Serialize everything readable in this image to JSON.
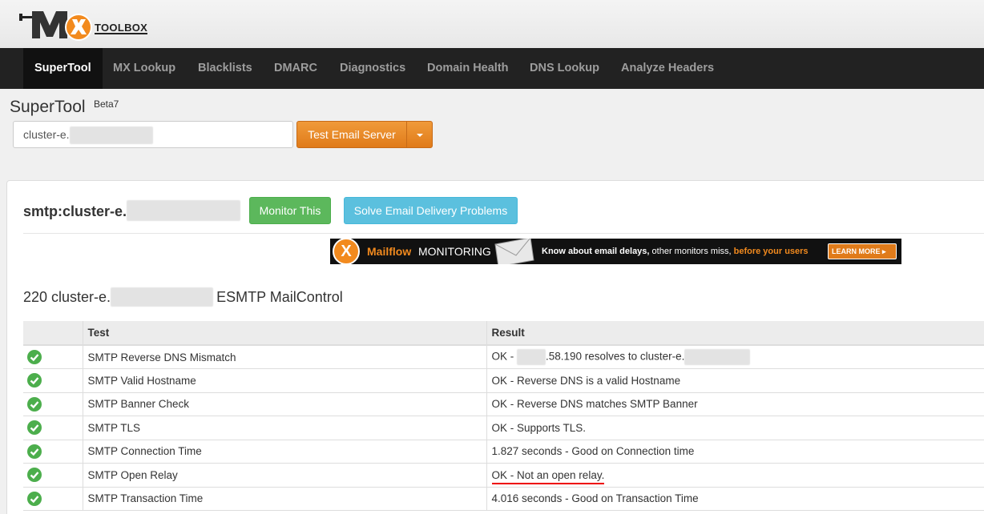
{
  "logo": {
    "wordmark": "TOOLBOX",
    "trademark": "®"
  },
  "nav": {
    "items": [
      "SuperTool",
      "MX Lookup",
      "Blacklists",
      "DMARC",
      "Diagnostics",
      "Domain Health",
      "DNS Lookup",
      "Analyze Headers"
    ],
    "active_index": 0
  },
  "supertool": {
    "title": "SuperTool",
    "badge": "Beta7",
    "input_value": "cluster-e.",
    "test_button": "Test Email Server"
  },
  "result_panel": {
    "heading": "smtp:cluster-e.",
    "monitor_button": "Monitor This",
    "solve_button": "Solve Email Delivery Problems",
    "banner": {
      "mailflow": "Mailflow",
      "monitoring": "MONITORING",
      "know": "Know about email delays,",
      "others": " other monitors miss, ",
      "before": "before your users",
      "learn_more": "LEARN MORE"
    },
    "server_banner_prefix": "220 cluster-e.",
    "server_banner_suffix": "ESMTP MailControl"
  },
  "table": {
    "columns": [
      "",
      "Test",
      "Result"
    ],
    "rows": [
      {
        "status": "ok",
        "test": "SMTP Reverse DNS Mismatch",
        "result_prefix": "OK - ",
        "result_mid": ".58.190 resolves to cluster-e."
      },
      {
        "status": "ok",
        "test": "SMTP Valid Hostname",
        "result": "OK - Reverse DNS is a valid Hostname"
      },
      {
        "status": "ok",
        "test": "SMTP Banner Check",
        "result": "OK - Reverse DNS matches SMTP Banner"
      },
      {
        "status": "ok",
        "test": "SMTP TLS",
        "result": "OK - Supports TLS."
      },
      {
        "status": "ok",
        "test": "SMTP Connection Time",
        "result": "1.827 seconds - Good on Connection time"
      },
      {
        "status": "ok",
        "test": "SMTP Open Relay",
        "result": "OK - Not an open relay."
      },
      {
        "status": "ok",
        "test": "SMTP Transaction Time",
        "result": "4.016 seconds - Good on Transaction Time"
      }
    ]
  },
  "colors": {
    "nav_bg": "#222222",
    "orange": "#e07b1a",
    "green": "#5cb85c",
    "info": "#5bc0de",
    "ok_icon": "#4cae4c",
    "highlight_underline": "#ee0000"
  }
}
